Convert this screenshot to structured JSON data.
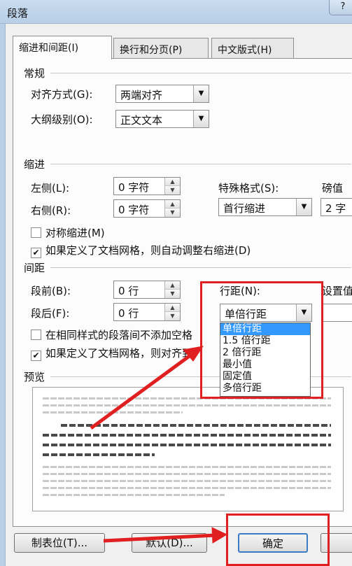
{
  "window": {
    "title": "段落",
    "help": "?"
  },
  "tabs": [
    {
      "label": "缩进和间距(I)"
    },
    {
      "label": "换行和分页(P)"
    },
    {
      "label": "中文版式(H)"
    }
  ],
  "general": {
    "heading": "常规",
    "alignment_label": "对齐方式(G):",
    "alignment_value": "两端对齐",
    "outline_label": "大纲级别(O):",
    "outline_value": "正文文本"
  },
  "indent": {
    "heading": "缩进",
    "left_label": "左侧(L):",
    "left_value": "0 字符",
    "right_label": "右侧(R):",
    "right_value": "0 字符",
    "special_label": "特殊格式(S):",
    "special_value": "首行缩进",
    "by_label": "磅值",
    "by_value": "2 字",
    "mirror_label": "对称缩进(M)",
    "auto_adjust_label": "如果定义了文档网格，则自动调整右缩进(D)"
  },
  "spacing": {
    "heading": "间距",
    "before_label": "段前(B):",
    "before_value": "0 行",
    "after_label": "段后(F):",
    "after_value": "0 行",
    "line_label": "行距(N):",
    "line_value": "单倍行距",
    "at_label": "设置值",
    "no_space_label": "在相同样式的段落间不添加空格",
    "snap_grid_label": "如果定义了文档网格，则对齐到"
  },
  "line_spacing_options": [
    "单倍行距",
    "1.5 倍行距",
    "2 倍行距",
    "最小值",
    "固定值",
    "多倍行距"
  ],
  "preview": {
    "heading": "预览"
  },
  "buttons": {
    "tabs": "制表位(T)...",
    "default": "默认(D)...",
    "ok": "确定"
  },
  "colors": {
    "annotation_red": "#e02020",
    "selection_blue": "#3399ff"
  },
  "icons": {
    "dropdown": "chevron-down-icon",
    "spinner_up": "spin-up-icon",
    "spinner_down": "spin-down-icon",
    "checkmark": "check-icon"
  }
}
